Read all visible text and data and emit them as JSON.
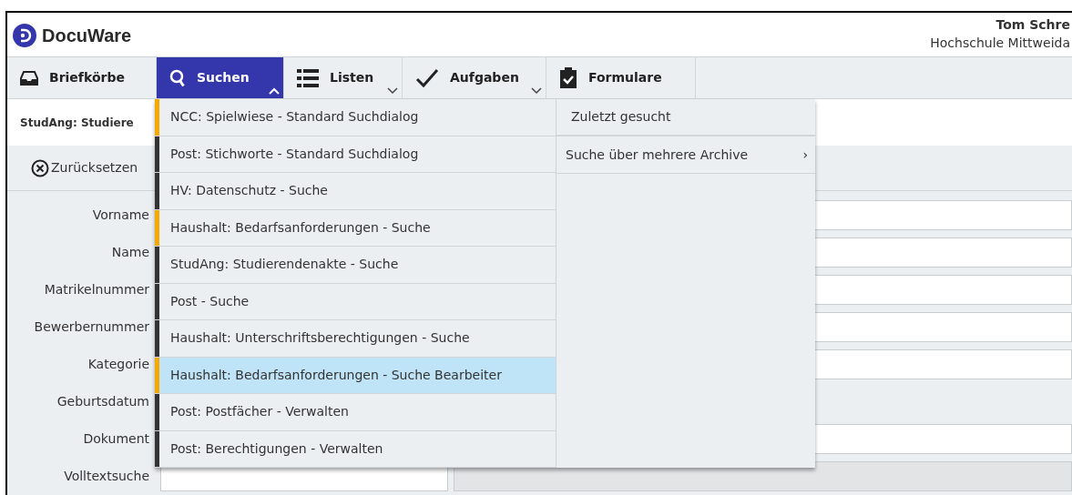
{
  "app": {
    "name": "DocuWare"
  },
  "user": {
    "name": "Tom Schre",
    "organization": "Hochschule Mittweida"
  },
  "nav": [
    {
      "label": "Briefkörbe",
      "selected": false,
      "dropdown": false
    },
    {
      "label": "Suchen",
      "selected": true,
      "dropdown": true
    },
    {
      "label": "Listen",
      "selected": false,
      "dropdown": true
    },
    {
      "label": "Aufgaben",
      "selected": false,
      "dropdown": true
    },
    {
      "label": "Formulare",
      "selected": false,
      "dropdown": false
    }
  ],
  "doc_tab": {
    "label": "StudAng: Studiere"
  },
  "toolbar": {
    "reset": "Zurücksetzen"
  },
  "form": [
    {
      "label": "Vorname",
      "kind": "text"
    },
    {
      "label": "Name",
      "kind": "text"
    },
    {
      "label": "Matrikelnummer",
      "kind": "text"
    },
    {
      "label": "Bewerbernummer",
      "kind": "text"
    },
    {
      "label": "Kategorie",
      "kind": "text"
    },
    {
      "label": "Geburtsdatum",
      "kind": "date"
    },
    {
      "label": "Dokument",
      "kind": "text"
    },
    {
      "label": "Volltextsuche",
      "kind": "fulltext"
    }
  ],
  "search_menu": {
    "items": [
      {
        "label": "NCC: Spielwiese - Standard Suchdialog",
        "color": "#f5a800",
        "selected": false
      },
      {
        "label": "Post: Stichworte - Standard Suchdialog",
        "color": "#333333",
        "selected": false
      },
      {
        "label": "HV: Datenschutz - Suche",
        "color": "#333333",
        "selected": false
      },
      {
        "label": "Haushalt: Bedarfsanforderungen - Suche",
        "color": "#f5a800",
        "selected": false
      },
      {
        "label": "StudAng: Studierendenakte - Suche",
        "color": "#333333",
        "selected": false
      },
      {
        "label": "Post - Suche",
        "color": "#333333",
        "selected": false
      },
      {
        "label": "Haushalt: Unterschriftsberechtigungen - Suche",
        "color": "#333333",
        "selected": false
      },
      {
        "label": "Haushalt: Bedarfsanforderungen - Suche Bearbeiter",
        "color": "#f5a800",
        "selected": true
      },
      {
        "label": "Post: Postfächer - Verwalten",
        "color": "#333333",
        "selected": false
      },
      {
        "label": "Post: Berechtigungen - Verwalten",
        "color": "#333333",
        "selected": false
      }
    ],
    "side": [
      {
        "label": "Zuletzt gesucht",
        "submenu": false
      },
      {
        "label": "Suche über mehrere Archive",
        "submenu": true
      }
    ],
    "submenu_glyph": "›"
  }
}
